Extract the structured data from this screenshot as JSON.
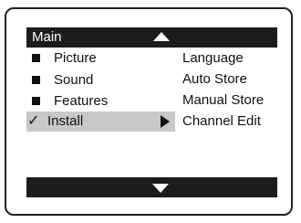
{
  "menu": {
    "title": "Main",
    "items": [
      {
        "label": "Picture",
        "icon": "square-bullet-icon",
        "selected": false
      },
      {
        "label": "Sound",
        "icon": "square-bullet-icon",
        "selected": false
      },
      {
        "label": "Features",
        "icon": "square-bullet-icon",
        "selected": false
      },
      {
        "label": "Install",
        "icon": "check-icon",
        "selected": true
      }
    ],
    "check_glyph": "✓"
  },
  "submenu": {
    "items": [
      "Language",
      "Auto Store",
      "Manual Store",
      "Channel Edit"
    ]
  },
  "colors": {
    "bar": "#1c1c1c",
    "highlight": "#c8c8c8",
    "text": "#111111",
    "background": "#ffffff"
  },
  "icons": {
    "scroll_up": "triangle-up-icon",
    "scroll_down": "triangle-down-icon",
    "submenu_arrow": "triangle-right-icon"
  }
}
